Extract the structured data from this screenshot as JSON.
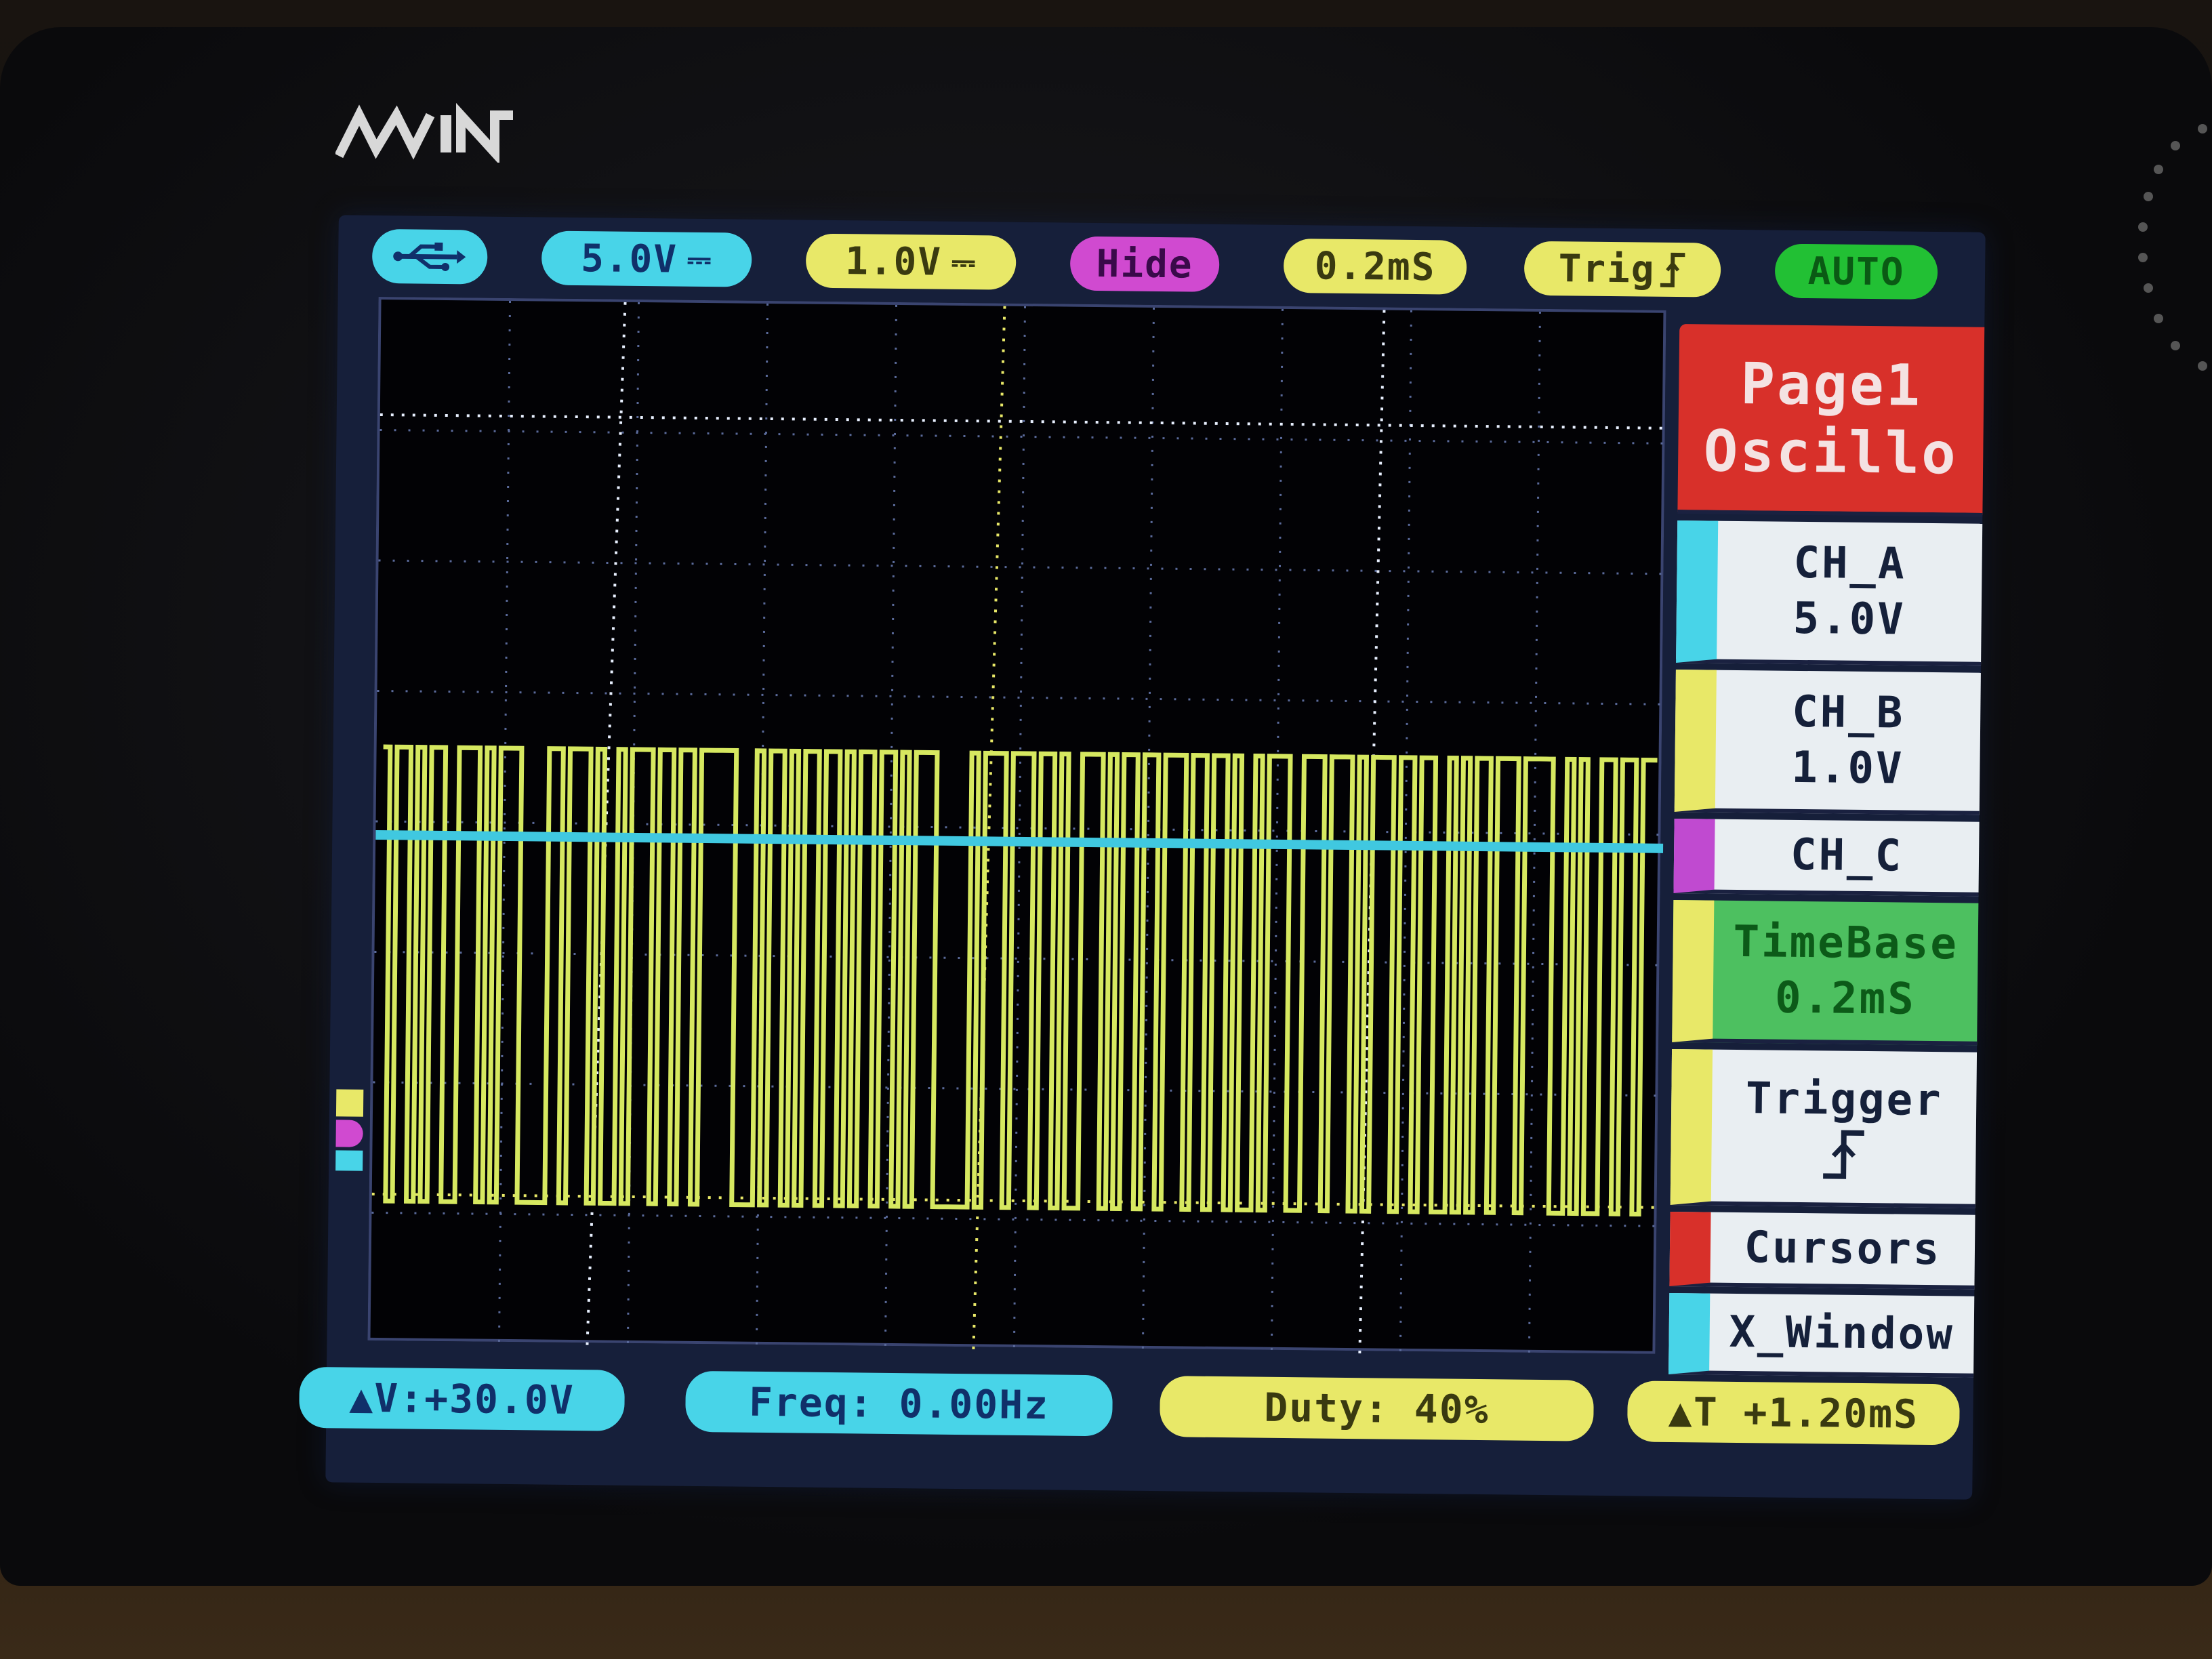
{
  "brand": {
    "logo": "MiN"
  },
  "status_bar": {
    "usb_icon": "usb-icon",
    "ch_a_scale": "5.0V",
    "ch_b_scale": "1.0V",
    "ch_c_state": "Hide",
    "timebase": "0.2mS",
    "trigger": "Trig",
    "trigger_edge_icon": "rising-edge-icon",
    "mode": "AUTO"
  },
  "menu": {
    "page1": {
      "line1": "Page1",
      "line2": "Oscillo"
    },
    "ch_a": {
      "line1": "CH_A",
      "line2": "5.0V"
    },
    "ch_b": {
      "line1": "CH_B",
      "line2": "1.0V"
    },
    "ch_c": {
      "line1": "CH_C"
    },
    "timebase": {
      "line1": "TimeBase",
      "line2": "0.2mS"
    },
    "trigger": {
      "line1": "Trigger",
      "icon": "rising-edge-icon"
    },
    "cursors": {
      "line1": "Cursors"
    },
    "x_window": {
      "line1": "X_Window"
    }
  },
  "measurements": {
    "delta_v": "▲V:+30.0V",
    "freq": "Freq: 0.00Hz",
    "duty": "Duty: 40%",
    "delta_t": "▲T +1.20mS"
  },
  "colors": {
    "cyan": "#48d4e8",
    "yellow": "#e8e868",
    "magenta": "#d04ad0",
    "green": "#22c034",
    "red": "#d8302a",
    "trace_b": "#d6e860",
    "trace_a": "#40c8e0"
  },
  "trace": {
    "ch_b_bits": "1011010110011101011100001101110100101110110110111110001011010110110101101101011100000101110111011010011101011011011101101101001011100111011101011101101100101011011101111001010011011011",
    "ch_a_level": "flat"
  }
}
